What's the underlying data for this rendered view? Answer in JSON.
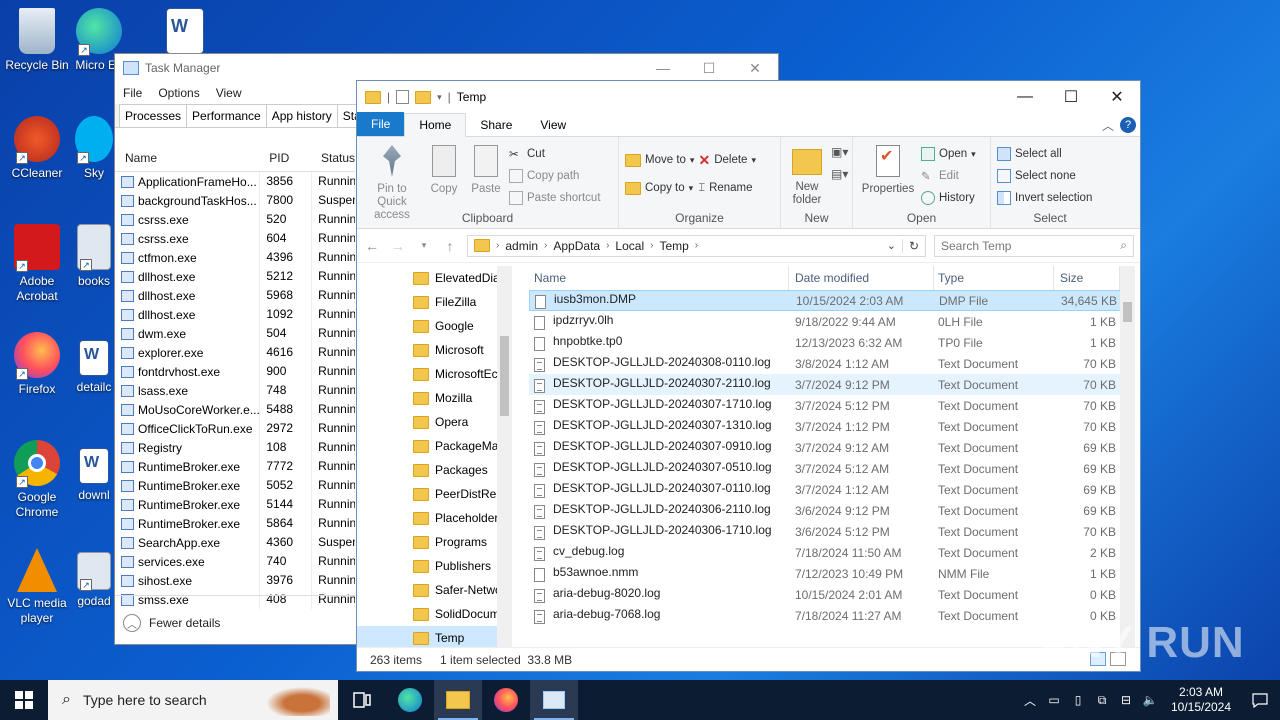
{
  "desktop": {
    "icons": [
      {
        "label": "Recycle Bin"
      },
      {
        "label": "Micro Ed"
      },
      {
        "label": "CCleaner"
      },
      {
        "label": "Sky"
      },
      {
        "label": "Adobe Acrobat"
      },
      {
        "label": "books"
      },
      {
        "label": "Firefox"
      },
      {
        "label": "detailc"
      },
      {
        "label": "Google Chrome"
      },
      {
        "label": "downl"
      },
      {
        "label": "VLC media player"
      },
      {
        "label": "godad"
      }
    ]
  },
  "task_manager": {
    "title": "Task Manager",
    "menu": [
      "File",
      "Options",
      "View"
    ],
    "tabs": [
      "Processes",
      "Performance",
      "App history",
      "Sta"
    ],
    "columns": {
      "name": "Name",
      "pid": "PID",
      "status": "Status"
    },
    "rows": [
      {
        "name": "ApplicationFrameHo...",
        "pid": "3856",
        "status": "Runnin"
      },
      {
        "name": "backgroundTaskHos...",
        "pid": "7800",
        "status": "Suspen"
      },
      {
        "name": "csrss.exe",
        "pid": "520",
        "status": "Runnin"
      },
      {
        "name": "csrss.exe",
        "pid": "604",
        "status": "Runnin"
      },
      {
        "name": "ctfmon.exe",
        "pid": "4396",
        "status": "Runnin"
      },
      {
        "name": "dllhost.exe",
        "pid": "5212",
        "status": "Runnin"
      },
      {
        "name": "dllhost.exe",
        "pid": "5968",
        "status": "Runnin"
      },
      {
        "name": "dllhost.exe",
        "pid": "1092",
        "status": "Runnin"
      },
      {
        "name": "dwm.exe",
        "pid": "504",
        "status": "Runnin"
      },
      {
        "name": "explorer.exe",
        "pid": "4616",
        "status": "Runnin"
      },
      {
        "name": "fontdrvhost.exe",
        "pid": "900",
        "status": "Runnin"
      },
      {
        "name": "lsass.exe",
        "pid": "748",
        "status": "Runnin"
      },
      {
        "name": "MoUsoCoreWorker.e...",
        "pid": "5488",
        "status": "Runnin"
      },
      {
        "name": "OfficeClickToRun.exe",
        "pid": "2972",
        "status": "Runnin"
      },
      {
        "name": "Registry",
        "pid": "108",
        "status": "Runnin"
      },
      {
        "name": "RuntimeBroker.exe",
        "pid": "7772",
        "status": "Runnin"
      },
      {
        "name": "RuntimeBroker.exe",
        "pid": "5052",
        "status": "Runnin"
      },
      {
        "name": "RuntimeBroker.exe",
        "pid": "5144",
        "status": "Runnin"
      },
      {
        "name": "RuntimeBroker.exe",
        "pid": "5864",
        "status": "Runnin"
      },
      {
        "name": "SearchApp.exe",
        "pid": "4360",
        "status": "Suspen"
      },
      {
        "name": "services.exe",
        "pid": "740",
        "status": "Runnin"
      },
      {
        "name": "sihost.exe",
        "pid": "3976",
        "status": "Runnin"
      },
      {
        "name": "smss.exe",
        "pid": "408",
        "status": "Runnin"
      }
    ],
    "fewer_details": "Fewer details"
  },
  "explorer": {
    "title": "Temp",
    "ribbon_tabs": {
      "file": "File",
      "home": "Home",
      "share": "Share",
      "view": "View"
    },
    "clipboard": {
      "pin": "Pin to Quick access",
      "copy": "Copy",
      "paste": "Paste",
      "cut": "Cut",
      "copy_path": "Copy path",
      "paste_shortcut": "Paste shortcut",
      "label": "Clipboard"
    },
    "organize": {
      "move_to": "Move to",
      "copy_to": "Copy to",
      "delete": "Delete",
      "rename": "Rename",
      "label": "Organize"
    },
    "new": {
      "new_folder": "New folder",
      "label": "New"
    },
    "open": {
      "properties": "Properties",
      "open": "Open",
      "edit": "Edit",
      "history": "History",
      "label": "Open"
    },
    "select": {
      "select_all": "Select all",
      "select_none": "Select none",
      "invert": "Invert selection",
      "label": "Select"
    },
    "breadcrumb": [
      "admin",
      "AppData",
      "Local",
      "Temp"
    ],
    "search_placeholder": "Search Temp",
    "nav_items": [
      "ElevatedDia",
      "FileZilla",
      "Google",
      "Microsoft",
      "MicrosoftEc",
      "Mozilla",
      "Opera",
      "PackageMa",
      "Packages",
      "PeerDistRep",
      "Placeholder",
      "Programs",
      "Publishers",
      "Safer-Netwo",
      "SolidDocum",
      "Temp"
    ],
    "columns": {
      "name": "Name",
      "date": "Date modified",
      "type": "Type",
      "size": "Size"
    },
    "files": [
      {
        "name": "iusb3mon.DMP",
        "date": "10/15/2024 2:03 AM",
        "type": "DMP File",
        "size": "34,645 KB"
      },
      {
        "name": "ipdzrryv.0lh",
        "date": "9/18/2022 9:44 AM",
        "type": "0LH File",
        "size": "1 KB"
      },
      {
        "name": "hnpobtke.tp0",
        "date": "12/13/2023 6:32 AM",
        "type": "TP0 File",
        "size": "1 KB"
      },
      {
        "name": "DESKTOP-JGLLJLD-20240308-0110.log",
        "date": "3/8/2024 1:12 AM",
        "type": "Text Document",
        "size": "70 KB"
      },
      {
        "name": "DESKTOP-JGLLJLD-20240307-2110.log",
        "date": "3/7/2024 9:12 PM",
        "type": "Text Document",
        "size": "70 KB"
      },
      {
        "name": "DESKTOP-JGLLJLD-20240307-1710.log",
        "date": "3/7/2024 5:12 PM",
        "type": "Text Document",
        "size": "70 KB"
      },
      {
        "name": "DESKTOP-JGLLJLD-20240307-1310.log",
        "date": "3/7/2024 1:12 PM",
        "type": "Text Document",
        "size": "70 KB"
      },
      {
        "name": "DESKTOP-JGLLJLD-20240307-0910.log",
        "date": "3/7/2024 9:12 AM",
        "type": "Text Document",
        "size": "69 KB"
      },
      {
        "name": "DESKTOP-JGLLJLD-20240307-0510.log",
        "date": "3/7/2024 5:12 AM",
        "type": "Text Document",
        "size": "69 KB"
      },
      {
        "name": "DESKTOP-JGLLJLD-20240307-0110.log",
        "date": "3/7/2024 1:12 AM",
        "type": "Text Document",
        "size": "69 KB"
      },
      {
        "name": "DESKTOP-JGLLJLD-20240306-2110.log",
        "date": "3/6/2024 9:12 PM",
        "type": "Text Document",
        "size": "69 KB"
      },
      {
        "name": "DESKTOP-JGLLJLD-20240306-1710.log",
        "date": "3/6/2024 5:12 PM",
        "type": "Text Document",
        "size": "70 KB"
      },
      {
        "name": "cv_debug.log",
        "date": "7/18/2024 11:50 AM",
        "type": "Text Document",
        "size": "2 KB"
      },
      {
        "name": "b53awnoe.nmm",
        "date": "7/12/2023 10:49 PM",
        "type": "NMM File",
        "size": "1 KB"
      },
      {
        "name": "aria-debug-8020.log",
        "date": "10/15/2024 2:01 AM",
        "type": "Text Document",
        "size": "0 KB"
      },
      {
        "name": "aria-debug-7068.log",
        "date": "7/18/2024 11:27 AM",
        "type": "Text Document",
        "size": "0 KB"
      }
    ],
    "status": {
      "items": "263 items",
      "selected": "1 item selected  33.8 MB"
    }
  },
  "taskbar": {
    "search_placeholder": "Type here to search",
    "time": "2:03 AM",
    "date": "10/15/2024"
  },
  "watermark": "ANY RUN"
}
